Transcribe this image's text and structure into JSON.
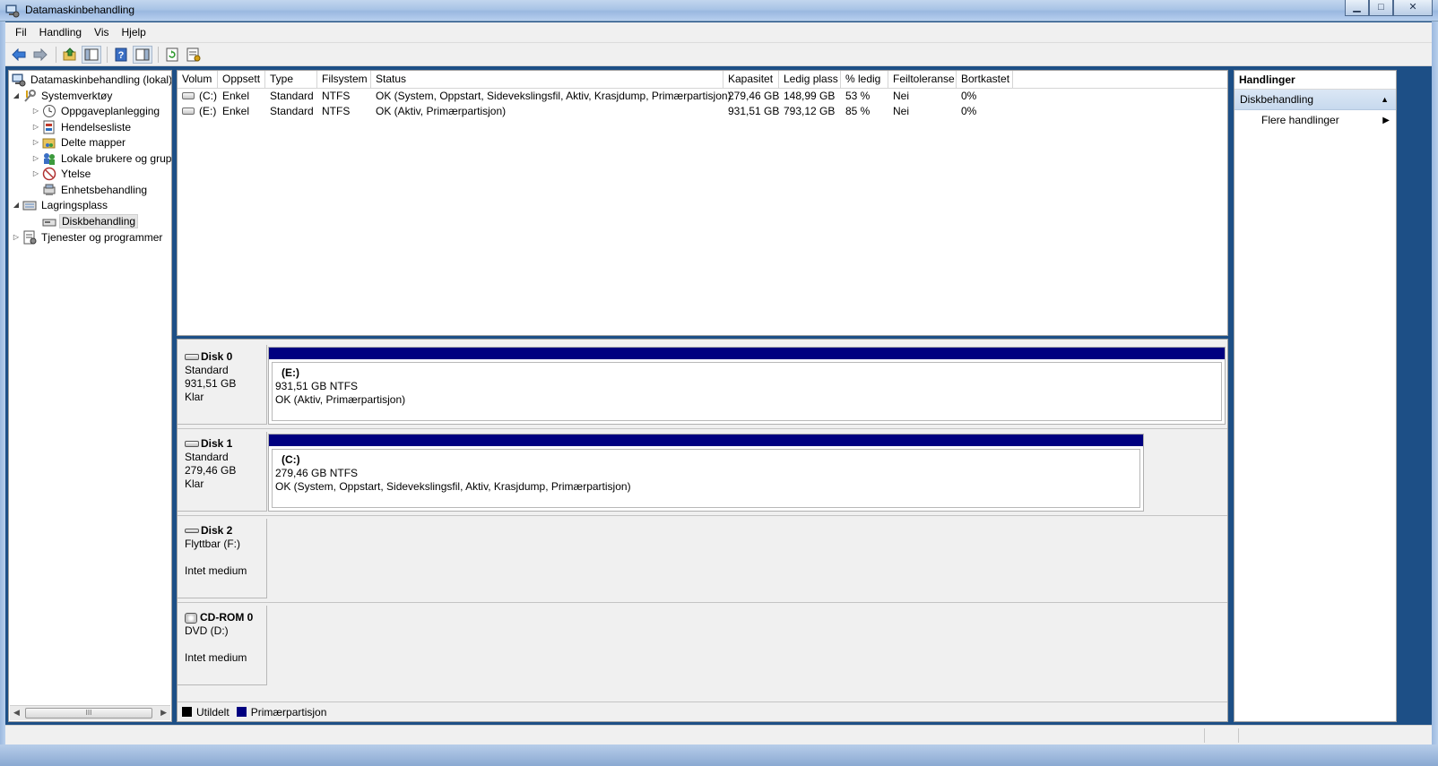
{
  "window": {
    "title": "Datamaskinbehandling",
    "minimize": "▁",
    "maximize": "□",
    "close": "✕"
  },
  "menu": [
    "Fil",
    "Handling",
    "Vis",
    "Hjelp"
  ],
  "toolbar": {
    "icons": [
      "back-arrow-icon",
      "forward-arrow-icon",
      "up-folder-icon",
      "show-hide-tree-icon",
      "help-icon",
      "show-hide-action-pane-icon",
      "refresh-icon",
      "properties-icon"
    ]
  },
  "tree": {
    "root": "Datamaskinbehandling (lokal)",
    "system_tools": "Systemverktøy",
    "task_scheduler": "Oppgaveplanlegging",
    "event_viewer": "Hendelsesliste",
    "shared_folders": "Delte mapper",
    "local_users": "Lokale brukere og grupp",
    "performance": "Ytelse",
    "device_manager": "Enhetsbehandling",
    "storage": "Lagringsplass",
    "disk_management": "Diskbehandling",
    "services": "Tjenester og programmer"
  },
  "scrollbar": {
    "grip": "III"
  },
  "volumes": {
    "headers": {
      "volum": "Volum",
      "oppsett": "Oppsett",
      "type": "Type",
      "filsystem": "Filsystem",
      "status": "Status",
      "kapasitet": "Kapasitet",
      "ledig": "Ledig plass",
      "pct": "% ledig",
      "feil": "Feiltoleranse",
      "bort": "Bortkastet"
    },
    "rows": [
      {
        "volum": "(C:)",
        "oppsett": "Enkel",
        "type": "Standard",
        "filsystem": "NTFS",
        "status": "OK (System, Oppstart, Sidevekslingsfil, Aktiv, Krasjdump, Primærpartisjon)",
        "kapasitet": "279,46 GB",
        "ledig": "148,99 GB",
        "pct": "53 %",
        "feil": "Nei",
        "bort": "0%"
      },
      {
        "volum": "(E:)",
        "oppsett": "Enkel",
        "type": "Standard",
        "filsystem": "NTFS",
        "status": "OK (Aktiv, Primærpartisjon)",
        "kapasitet": "931,51 GB",
        "ledig": "793,12 GB",
        "pct": "85 %",
        "feil": "Nei",
        "bort": "0%"
      }
    ]
  },
  "disks": {
    "disk0": {
      "name": "Disk 0",
      "type": "Standard",
      "size": "931,51 GB",
      "state": "Klar",
      "part_name": "(E:)",
      "part_size": "931,51 GB NTFS",
      "part_status": "OK (Aktiv, Primærpartisjon)"
    },
    "disk1": {
      "name": "Disk 1",
      "type": "Standard",
      "size": "279,46 GB",
      "state": "Klar",
      "part_name": "(C:)",
      "part_size": "279,46 GB NTFS",
      "part_status": "OK (System, Oppstart, Sidevekslingsfil, Aktiv, Krasjdump, Primærpartisjon)"
    },
    "disk2": {
      "name": "Disk 2",
      "type": "Flyttbar (F:)",
      "state": "Intet medium"
    },
    "cdrom0": {
      "name": "CD-ROM 0",
      "type": "DVD (D:)",
      "state": "Intet medium"
    }
  },
  "legend": {
    "unallocated": "Utildelt",
    "primary": "Primærpartisjon",
    "unallocated_color": "#000000",
    "primary_color": "#000080"
  },
  "actions": {
    "header": "Handlinger",
    "section": "Diskbehandling",
    "more": "Flere handlinger",
    "collapse_glyph": "▲",
    "more_glyph": "▶"
  },
  "colors": {
    "partition_bar": "#000080",
    "selection": "#e5e5e5"
  }
}
